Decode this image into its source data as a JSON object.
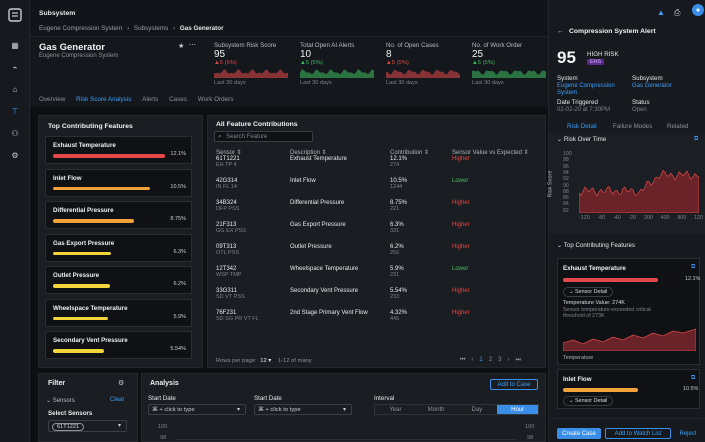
{
  "topbar": {
    "title": "Subsystem",
    "breadcrumb": [
      "Eugene Compression System",
      "Subsystems",
      "Gas Generator"
    ],
    "sep": "›"
  },
  "header": {
    "title": "Gas Generator",
    "subtitle": "Eugene Compression System",
    "kpis": [
      {
        "label": "Subsystem Risk Score",
        "value": "95",
        "change": "▲5 (5%)",
        "change_color": "red",
        "period": "Last 30 days"
      },
      {
        "label": "Total Open AI Alerts",
        "value": "10",
        "change": "▲5 (5%)",
        "change_color": "green",
        "period": "Last 30 days"
      },
      {
        "label": "No. of Open Cases",
        "value": "8",
        "change": "▲5 (5%)",
        "change_color": "red",
        "period": "Last 30 days"
      },
      {
        "label": "No. of Work Order",
        "value": "25",
        "change": "▲5 (5%)",
        "change_color": "green",
        "period": "Last 30 days"
      }
    ],
    "tabs": [
      "Overview",
      "Risk Score Analysis",
      "Alerts",
      "Cases",
      "Work Orders"
    ],
    "active_tab": "Risk Score Analysis"
  },
  "top_features": {
    "title": "Top Contributing Features",
    "items": [
      {
        "name": "Exhaust Temperature",
        "pct": "12.1%",
        "fraction": 0.121,
        "color": "#e54848"
      },
      {
        "name": "Inlet Flow",
        "pct": "10.5%",
        "fraction": 0.105,
        "color": "#f2a33a"
      },
      {
        "name": "Differential Pressure",
        "pct": "8.75%",
        "fraction": 0.0875,
        "color": "#f2a33a"
      },
      {
        "name": "Gas Export Pressure",
        "pct": "6.3%",
        "fraction": 0.063,
        "color": "#f2d53a"
      },
      {
        "name": "Outlet Pressure",
        "pct": "6.2%",
        "fraction": 0.062,
        "color": "#f2d53a"
      },
      {
        "name": "Wheelspace Temperature",
        "pct": "5.9%",
        "fraction": 0.059,
        "color": "#f2d53a"
      },
      {
        "name": "Secondary Vent Pressure",
        "pct": "5.54%",
        "fraction": 0.0554,
        "color": "#f2d53a"
      }
    ]
  },
  "all_features": {
    "title": "All Feature Contributions",
    "search_placeholder": "Search Feature",
    "columns": [
      "Sensor ⇕",
      "Description ⇕",
      "Contribution ⇕",
      "Sensor Value vs Expected ⇕"
    ],
    "rows": [
      {
        "sensor": "61T1221",
        "tag": "EH TP 4",
        "desc": "Exhaust Temperature",
        "contrib": "12.1%",
        "contrib_sub": "274",
        "status": "Higher",
        "status_color": "red"
      },
      {
        "sensor": "42G314",
        "tag": "IN FL 14",
        "desc": "Inlet Flow",
        "contrib": "10.5%",
        "contrib_sub": "1244",
        "status": "Lower",
        "status_color": "green"
      },
      {
        "sensor": "34B324",
        "tag": "DFP PSS",
        "desc": "Differential Pressure",
        "contrib": "8.75%",
        "contrib_sub": "221",
        "status": "Higher",
        "status_color": "red"
      },
      {
        "sensor": "21F313",
        "tag": "GG EX PSS",
        "desc": "Gas Export Pressure",
        "contrib": "6.3%",
        "contrib_sub": "331",
        "status": "Higher",
        "status_color": "red"
      },
      {
        "sensor": "09T313",
        "tag": "OTL PSS",
        "desc": "Outlet Pressure",
        "contrib": "6.2%",
        "contrib_sub": "256",
        "status": "Higher",
        "status_color": "red"
      },
      {
        "sensor": "12T342",
        "tag": "WSP TMP",
        "desc": "Wheelspace Temperature",
        "contrib": "5.9%",
        "contrib_sub": "231",
        "status": "Lower",
        "status_color": "green"
      },
      {
        "sensor": "33G311",
        "tag": "SD VT PSS",
        "desc": "Secondary Vent Pressure",
        "contrib": "5.54%",
        "contrib_sub": "233",
        "status": "Higher",
        "status_color": "red"
      },
      {
        "sensor": "76F231",
        "tag": "SD SG PR VT FL",
        "desc": "2nd Stage Primary Vent Flow",
        "contrib": "4.32%",
        "contrib_sub": "445",
        "status": "Higher",
        "status_color": "red"
      }
    ],
    "rows_per_page_label": "Rows per page:",
    "rows_per_page": "12 ▾",
    "range": "1-12 of many",
    "pages": [
      "1",
      "2",
      "3"
    ],
    "current_page": "1"
  },
  "filter": {
    "title": "Filter",
    "sensors_label": "Sensors",
    "clear": "Clear",
    "select_label": "Select Sensors",
    "chip": "61T1221"
  },
  "analysis": {
    "title": "Analysis",
    "add_to_case": "Add to Case",
    "start_date_label": "Start Date",
    "start_date_placeholder": "⌘ + click to type",
    "interval_label": "Interval",
    "intervals": [
      "Year",
      "Month",
      "Day",
      "Hour"
    ],
    "active_interval": "Hour",
    "y_ticks": [
      "100",
      "98"
    ]
  },
  "alert": {
    "title": "Compression System Alert",
    "score": "95",
    "risk_label": "HIGH RISK",
    "badge": "EHS",
    "system_label": "System",
    "system_value": "Eugene Compression System",
    "subsystem_label": "Subsystem",
    "subsystem_value": "Gas Generator",
    "date_label": "Date Triggered",
    "date_value": "02-02-20 at 7:30PM",
    "status_label": "Status",
    "status_value": "Open",
    "tabs": [
      "Risk Detail",
      "Failure Modes",
      "Related"
    ],
    "risk_over_time": "Risk Over Time",
    "y_axis_label": "Risk Score",
    "y_ticks": [
      "100",
      "98",
      "96",
      "94",
      "92",
      "90",
      "88",
      "86",
      "84",
      "82"
    ],
    "x_ticks": [
      "-120",
      "-80",
      "-40",
      "-20",
      "200",
      "400",
      "800",
      "120"
    ],
    "x_ticks_sub": "0",
    "top_features_label": "Top Contributing Features",
    "card1_title": "Exhaust Temperature",
    "card1_pct": "12.1%",
    "sensor_detail": "Sensor Detail",
    "card1_value": "Temperature Value: 274K",
    "card1_desc": "Sensor temperature exceeded critical threshold of 273K",
    "card1_chart_label": "Temperature",
    "card2_title": "Inlet Flow",
    "card2_pct": "10.5%",
    "create_case": "Create Case",
    "add_watch": "Add to Watch List",
    "reject": "Reject"
  }
}
